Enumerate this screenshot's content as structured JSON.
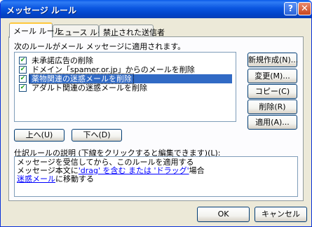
{
  "window": {
    "title": "メッセージ ルール",
    "help_glyph": "?",
    "close_glyph": "✕"
  },
  "tabs": [
    {
      "label": "メール ルール",
      "active": true
    },
    {
      "label": "ニュース ルール",
      "active": false
    },
    {
      "label": "禁止された送信者",
      "active": false
    }
  ],
  "instruction": "次のルールがメール メッセージに適用されます。",
  "rules": [
    {
      "label": "未承諾広告の削除",
      "checked": true,
      "selected": false
    },
    {
      "label": "ドメイン「spamer.or.jp」からのメールを削除",
      "checked": true,
      "selected": false
    },
    {
      "label": "薬物関連の迷惑メールを削除",
      "checked": true,
      "selected": true
    },
    {
      "label": "アダルト関連の迷惑メールを削除",
      "checked": true,
      "selected": false
    }
  ],
  "side_buttons": {
    "new": "新規作成(N)...",
    "change": "変更(M)...",
    "copy": "コピー(C)",
    "delete": "削除(R)",
    "apply": "適用(A)..."
  },
  "order_buttons": {
    "up": "上へ(U)",
    "down": "下へ(D)"
  },
  "description": {
    "label": "仕訳ルールの説明 (下線をクリックすると編集できます)(L):",
    "line1": "メッセージを受信してから、このルールを適用する",
    "line2_prefix": "メッセージ本文に",
    "line2_link": "'drag' を含む または 'ドラッグ'",
    "line2_suffix": "場合",
    "line3_link": "迷惑メール",
    "line3_suffix": "に移動する"
  },
  "footer": {
    "ok": "OK",
    "cancel": "キャンセル"
  },
  "colors": {
    "titlebar": "#0a55e0",
    "selection": "#316ac5",
    "link": "#0000ff",
    "face": "#ece9d8"
  }
}
